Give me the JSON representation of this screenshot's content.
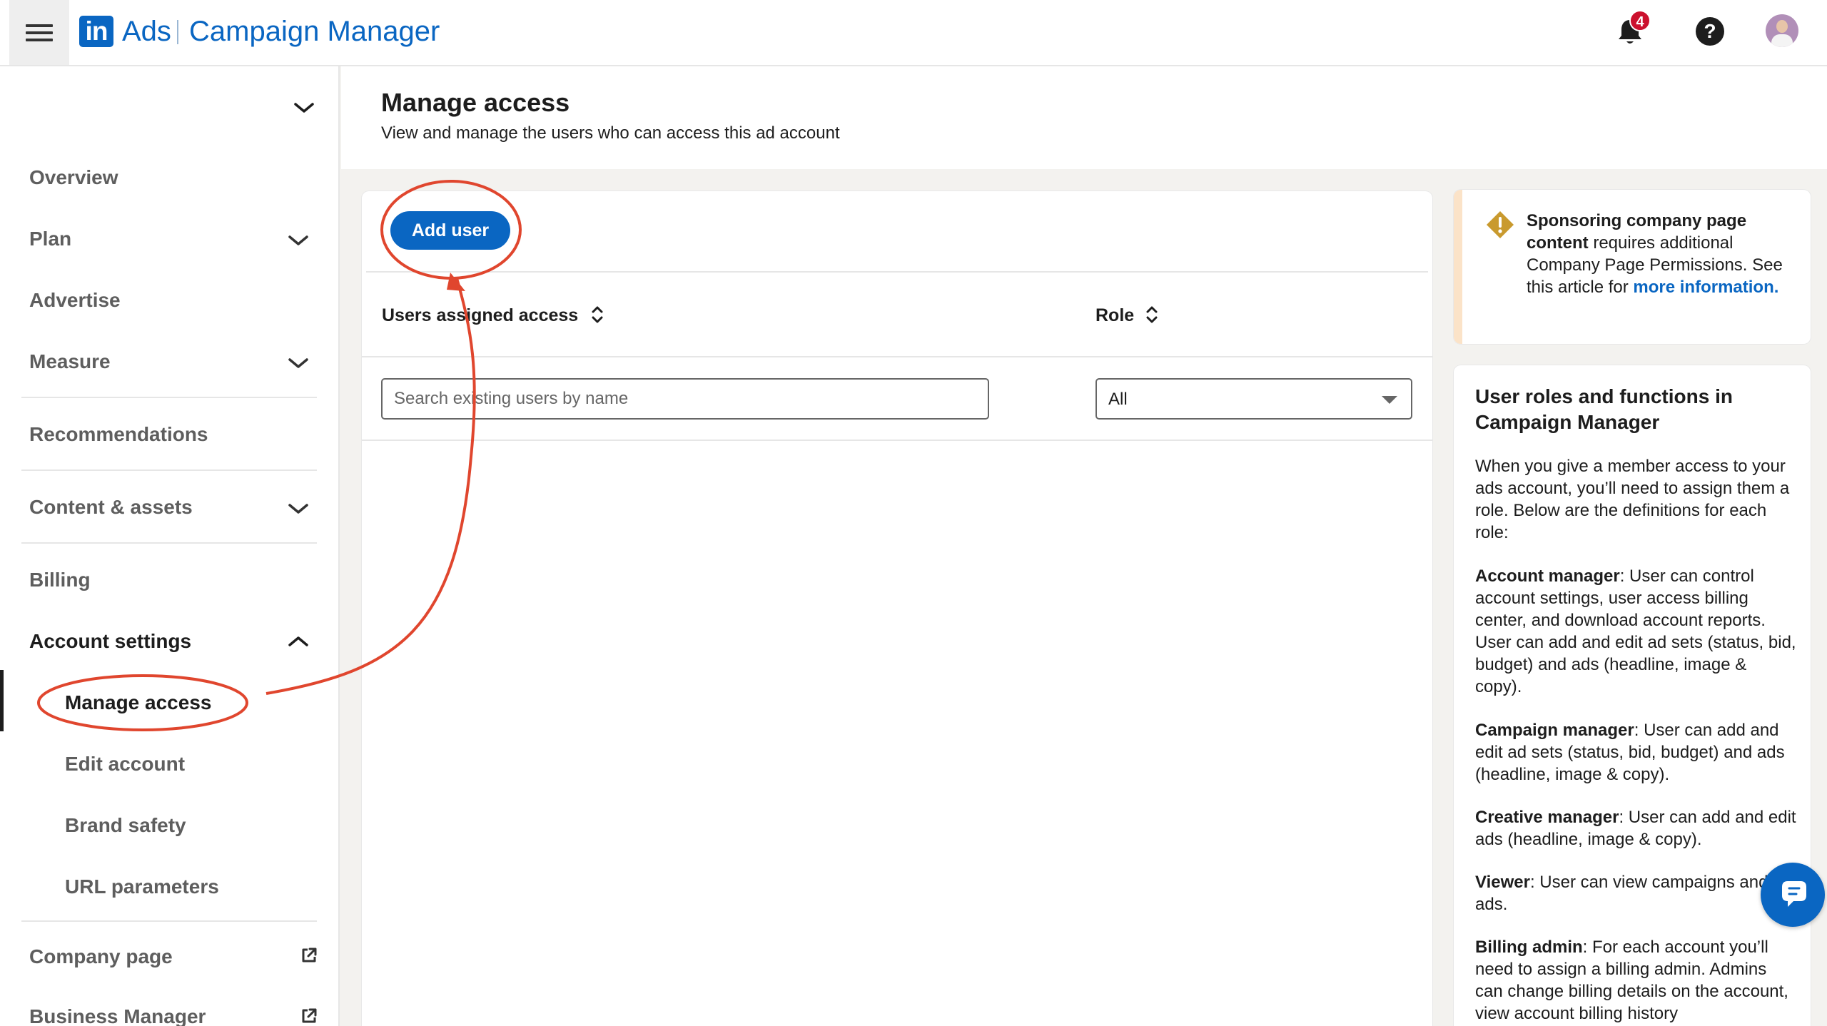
{
  "header": {
    "logo_text": "in",
    "brand_ads": "Ads",
    "brand_product": "Campaign Manager",
    "notification_count": "4"
  },
  "sidebar": {
    "items": {
      "overview": "Overview",
      "plan": "Plan",
      "advertise": "Advertise",
      "measure": "Measure",
      "recommendations": "Recommendations",
      "content_assets": "Content & assets",
      "billing": "Billing",
      "account_settings": "Account settings",
      "company_page": "Company page",
      "business_manager": "Business Manager"
    },
    "account_settings_sub": {
      "manage_access": "Manage access",
      "edit_account": "Edit account",
      "brand_safety": "Brand safety",
      "url_parameters": "URL parameters"
    }
  },
  "page": {
    "title": "Manage access",
    "subtitle": "View and manage the users who can access this ad account"
  },
  "main": {
    "add_user_label": "Add user",
    "col_users": "Users assigned access",
    "col_role": "Role",
    "search_placeholder": "Search existing users by name",
    "role_filter_value": "All"
  },
  "notice": {
    "bold_part": "Sponsoring company page content",
    "text_part": " requires additional Company Page Permissions. See this article for ",
    "link_text": "more information",
    "end": "."
  },
  "roles_panel": {
    "title": "User roles and functions in Campaign Manager",
    "intro": "When you give a member access to your ads account, you’ll need to assign them a role. Below are the definitions for each role:",
    "roles": [
      {
        "name": "Account manager",
        "desc": ": User can control account settings, user access billing center, and download account reports. User can add and edit ad sets (status, bid, budget) and ads (headline, image & copy)."
      },
      {
        "name": "Campaign manager",
        "desc": ": User can add and edit ad sets (status, bid, budget) and ads (headline, image & copy)."
      },
      {
        "name": "Creative manager",
        "desc": ": User can add and edit ads (headline, image & copy)."
      },
      {
        "name": "Viewer",
        "desc": ": User can view campaigns and ads."
      },
      {
        "name": "Billing admin",
        "desc": ": For each account you’ll need to assign a billing admin. Admins can change billing details on the account, view account billing history"
      }
    ]
  },
  "colors": {
    "brand_blue": "#0a66c2",
    "annotation_red": "#e0462e",
    "badge_red": "#cb112d",
    "warning_gold": "#c99a2e"
  }
}
